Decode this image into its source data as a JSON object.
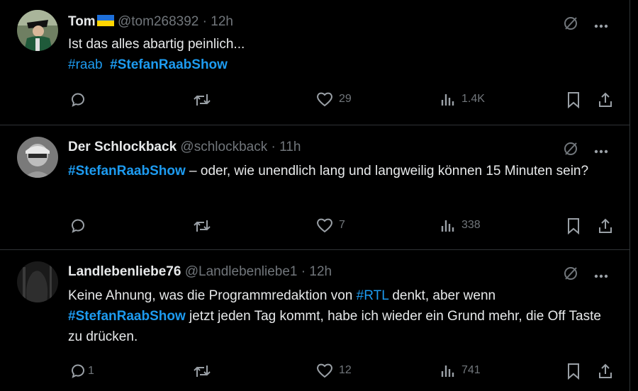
{
  "tweets": [
    {
      "name": "Tom",
      "handle": "@tom268392",
      "time": "12h",
      "text": "Ist das alles abartig peinlich...",
      "tag1": "#raab",
      "tag2": "#StefanRaabShow",
      "stats": {
        "replies": "",
        "likes": "29",
        "views": "1.4K"
      }
    },
    {
      "name": "Der Schlockback",
      "handle": "@schlockback",
      "time": "11h",
      "tag": "#StefanRaabShow",
      "text": " – oder, wie unendlich lang und langweilig können 15 Minuten sein?",
      "stats": {
        "replies": "",
        "likes": "7",
        "views": "338"
      }
    },
    {
      "name": "Landlebenliebe76",
      "handle": "@Landlebenliebe1",
      "time": "12h",
      "text_a": "Keine Ahnung,  was die Programmredaktion von ",
      "tag_a": "#RTL",
      "text_b": " denkt, aber wenn",
      "tag_b": "#StefanRaabShow",
      "text_c": " jetzt jeden Tag kommt, habe ich wieder ein Grund mehr, die Off Taste zu drücken.",
      "stats": {
        "replies": "1",
        "likes": "12",
        "views": "741"
      }
    }
  ],
  "separator": " · ",
  "icons": [
    "grok-icon",
    "more-icon",
    "reply-icon",
    "retweet-icon",
    "like-icon",
    "views-icon",
    "bookmark-icon",
    "share-icon"
  ],
  "colors": {
    "background": "#000000",
    "text": "#e7e9ea",
    "muted": "#71767b",
    "link": "#1d9bf0",
    "divider": "#2f3336"
  }
}
